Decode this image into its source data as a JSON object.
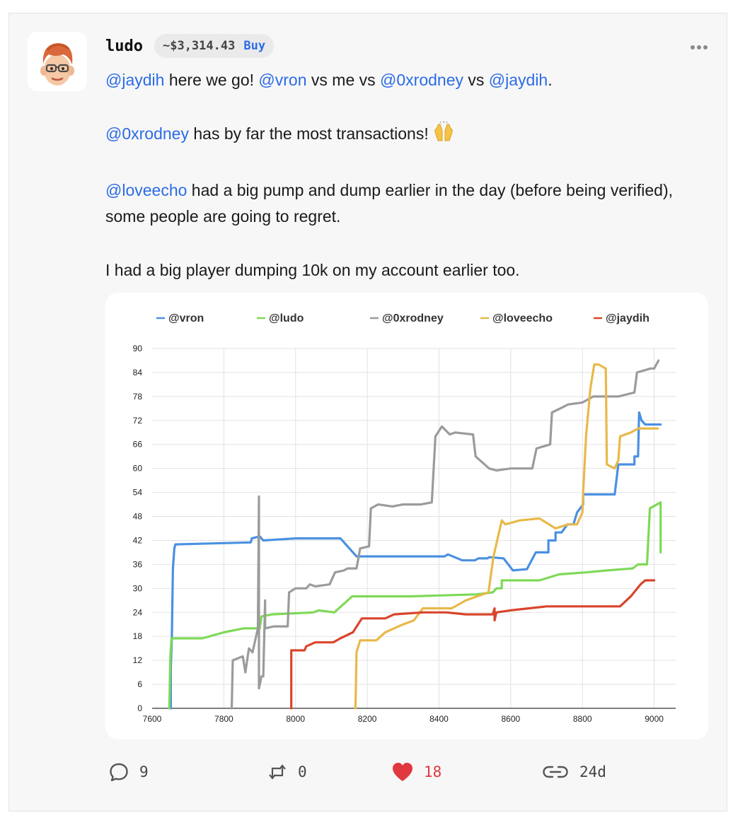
{
  "post": {
    "author": "ludo",
    "price": "~$3,314.43",
    "buy_label": "Buy",
    "paragraphs": [
      [
        {
          "text": "@jaydih",
          "mention": true
        },
        {
          "text": " here we go! "
        },
        {
          "text": "@vron",
          "mention": true
        },
        {
          "text": " vs me vs "
        },
        {
          "text": "@0xrodney",
          "mention": true
        },
        {
          "text": " vs "
        },
        {
          "text": "@jaydih",
          "mention": true
        },
        {
          "text": "."
        }
      ],
      [
        {
          "text": "@0xrodney",
          "mention": true
        },
        {
          "text": " has by far the most transactions!"
        },
        {
          "emoji": "raising-hands"
        }
      ],
      [
        {
          "text": "@loveecho",
          "mention": true
        },
        {
          "text": " had a big pump and dump earlier in the day (before being verified), some people are going to regret."
        }
      ],
      [
        {
          "text": "I had a big player dumping 10k on my account earlier too."
        }
      ]
    ]
  },
  "actions": {
    "comments": "9",
    "recasts": "0",
    "likes": "18",
    "age": "24d"
  },
  "colors": {
    "mention": "#2b6ce6",
    "like": "#e0383e"
  },
  "chart_data": {
    "type": "line",
    "title": "",
    "xlabel": "",
    "ylabel": "",
    "xlim": [
      7600,
      9060
    ],
    "ylim": [
      0,
      90
    ],
    "x_ticks": [
      7600,
      7800,
      8000,
      8200,
      8400,
      8600,
      8800,
      9000
    ],
    "y_ticks": [
      0,
      6,
      12,
      18,
      24,
      30,
      36,
      42,
      48,
      54,
      60,
      66,
      72,
      78,
      84,
      90
    ],
    "grid": true,
    "legend_position": "top",
    "series": [
      {
        "name": "@vron",
        "color": "#4a90e2",
        "points": [
          [
            7652,
            0
          ],
          [
            7652,
            10
          ],
          [
            7655,
            18
          ],
          [
            7658,
            35
          ],
          [
            7662,
            40
          ],
          [
            7665,
            41
          ],
          [
            7875,
            41.5
          ],
          [
            7878,
            42.5
          ],
          [
            7900,
            43
          ],
          [
            7910,
            42
          ],
          [
            8000,
            42.5
          ],
          [
            8125,
            42.5
          ],
          [
            8170,
            38
          ],
          [
            8415,
            38
          ],
          [
            8425,
            38.5
          ],
          [
            8465,
            37
          ],
          [
            8500,
            37
          ],
          [
            8510,
            37.5
          ],
          [
            8535,
            37.5
          ],
          [
            8540,
            37.8
          ],
          [
            8580,
            37.5
          ],
          [
            8606,
            34.5
          ],
          [
            8645,
            34.8
          ],
          [
            8670,
            39
          ],
          [
            8705,
            39
          ],
          [
            8705,
            42
          ],
          [
            8725,
            42
          ],
          [
            8725,
            44
          ],
          [
            8742,
            44
          ],
          [
            8758,
            46
          ],
          [
            8775,
            46
          ],
          [
            8785,
            49
          ],
          [
            8802,
            51
          ],
          [
            8802,
            53.5
          ],
          [
            8890,
            53.5
          ],
          [
            8900,
            61
          ],
          [
            8945,
            61
          ],
          [
            8945,
            63
          ],
          [
            8955,
            63
          ],
          [
            8958,
            74
          ],
          [
            8965,
            72
          ],
          [
            8975,
            71
          ],
          [
            9018,
            71
          ]
        ]
      },
      {
        "name": "@ludo",
        "color": "#7ed957",
        "points": [
          [
            7648,
            0
          ],
          [
            7651,
            13
          ],
          [
            7654,
            17.5
          ],
          [
            7740,
            17.5
          ],
          [
            7800,
            19
          ],
          [
            7855,
            20
          ],
          [
            7900,
            20
          ],
          [
            7905,
            23
          ],
          [
            7935,
            23.5
          ],
          [
            8050,
            24
          ],
          [
            8065,
            24.5
          ],
          [
            8108,
            24
          ],
          [
            8158,
            28
          ],
          [
            8320,
            28
          ],
          [
            8505,
            28.5
          ],
          [
            8550,
            29
          ],
          [
            8560,
            30
          ],
          [
            8575,
            30
          ],
          [
            8575,
            32
          ],
          [
            8680,
            32
          ],
          [
            8735,
            33.5
          ],
          [
            8810,
            34
          ],
          [
            8870,
            34.5
          ],
          [
            8940,
            35
          ],
          [
            8955,
            36
          ],
          [
            8980,
            36
          ],
          [
            8988,
            50
          ],
          [
            9018,
            51.5
          ],
          [
            9018,
            39
          ]
        ]
      },
      {
        "name": "@0xrodney",
        "color": "#9b9b9b",
        "points": [
          [
            7822,
            0
          ],
          [
            7825,
            12
          ],
          [
            7853,
            13
          ],
          [
            7860,
            9
          ],
          [
            7870,
            15
          ],
          [
            7880,
            14
          ],
          [
            7895,
            20
          ],
          [
            7898,
            53
          ],
          [
            7898,
            5
          ],
          [
            7905,
            8
          ],
          [
            7910,
            8
          ],
          [
            7915,
            27
          ],
          [
            7915,
            20
          ],
          [
            7940,
            20.5
          ],
          [
            7978,
            20.5
          ],
          [
            7982,
            29
          ],
          [
            8000,
            30
          ],
          [
            8030,
            30
          ],
          [
            8040,
            31
          ],
          [
            8055,
            30.5
          ],
          [
            8095,
            31
          ],
          [
            8110,
            34
          ],
          [
            8135,
            34.5
          ],
          [
            8145,
            35
          ],
          [
            8170,
            35
          ],
          [
            8180,
            40
          ],
          [
            8205,
            40.5
          ],
          [
            8210,
            50
          ],
          [
            8230,
            51
          ],
          [
            8270,
            50.5
          ],
          [
            8300,
            51
          ],
          [
            8350,
            51
          ],
          [
            8380,
            51.5
          ],
          [
            8390,
            68
          ],
          [
            8408,
            70.5
          ],
          [
            8430,
            68.5
          ],
          [
            8445,
            69
          ],
          [
            8495,
            68.5
          ],
          [
            8502,
            63
          ],
          [
            8540,
            60
          ],
          [
            8560,
            59.5
          ],
          [
            8600,
            60
          ],
          [
            8660,
            60
          ],
          [
            8672,
            65
          ],
          [
            8710,
            66
          ],
          [
            8715,
            74
          ],
          [
            8738,
            75
          ],
          [
            8760,
            76
          ],
          [
            8800,
            76.5
          ],
          [
            8830,
            78
          ],
          [
            8868,
            78
          ],
          [
            8900,
            78
          ],
          [
            8945,
            79
          ],
          [
            8952,
            84
          ],
          [
            8990,
            85
          ],
          [
            9000,
            85
          ],
          [
            9012,
            87
          ]
        ]
      },
      {
        "name": "@loveecho",
        "color": "#e8b949",
        "points": [
          [
            8167,
            0
          ],
          [
            8170,
            14
          ],
          [
            8180,
            17
          ],
          [
            8225,
            17
          ],
          [
            8250,
            19
          ],
          [
            8300,
            21
          ],
          [
            8330,
            22
          ],
          [
            8355,
            25
          ],
          [
            8435,
            25
          ],
          [
            8455,
            26
          ],
          [
            8475,
            27
          ],
          [
            8538,
            29
          ],
          [
            8552,
            38
          ],
          [
            8575,
            47
          ],
          [
            8585,
            46
          ],
          [
            8625,
            47
          ],
          [
            8680,
            47.5
          ],
          [
            8725,
            45
          ],
          [
            8760,
            46
          ],
          [
            8785,
            46
          ],
          [
            8800,
            49
          ],
          [
            8802,
            54
          ],
          [
            8810,
            68
          ],
          [
            8822,
            80
          ],
          [
            8833,
            86
          ],
          [
            8845,
            86
          ],
          [
            8865,
            85
          ],
          [
            8868,
            61
          ],
          [
            8890,
            60
          ],
          [
            8900,
            62
          ],
          [
            8905,
            68
          ],
          [
            8935,
            69
          ],
          [
            8955,
            70
          ],
          [
            9010,
            70
          ]
        ]
      },
      {
        "name": "@jaydih",
        "color": "#d9452c",
        "points": [
          [
            7988,
            0
          ],
          [
            7988,
            14.5
          ],
          [
            8025,
            14.5
          ],
          [
            8030,
            15.5
          ],
          [
            8055,
            16.5
          ],
          [
            8105,
            16.5
          ],
          [
            8125,
            17.5
          ],
          [
            8160,
            19
          ],
          [
            8185,
            22.5
          ],
          [
            8250,
            22.5
          ],
          [
            8275,
            23.5
          ],
          [
            8355,
            24
          ],
          [
            8420,
            24
          ],
          [
            8475,
            23.5
          ],
          [
            8550,
            23.5
          ],
          [
            8555,
            25
          ],
          [
            8555,
            22
          ],
          [
            8560,
            24
          ],
          [
            8600,
            24.5
          ],
          [
            8700,
            25.5
          ],
          [
            8805,
            25.5
          ],
          [
            8905,
            25.5
          ],
          [
            8935,
            28
          ],
          [
            8962,
            31
          ],
          [
            8975,
            32
          ],
          [
            9000,
            32
          ]
        ]
      }
    ]
  }
}
